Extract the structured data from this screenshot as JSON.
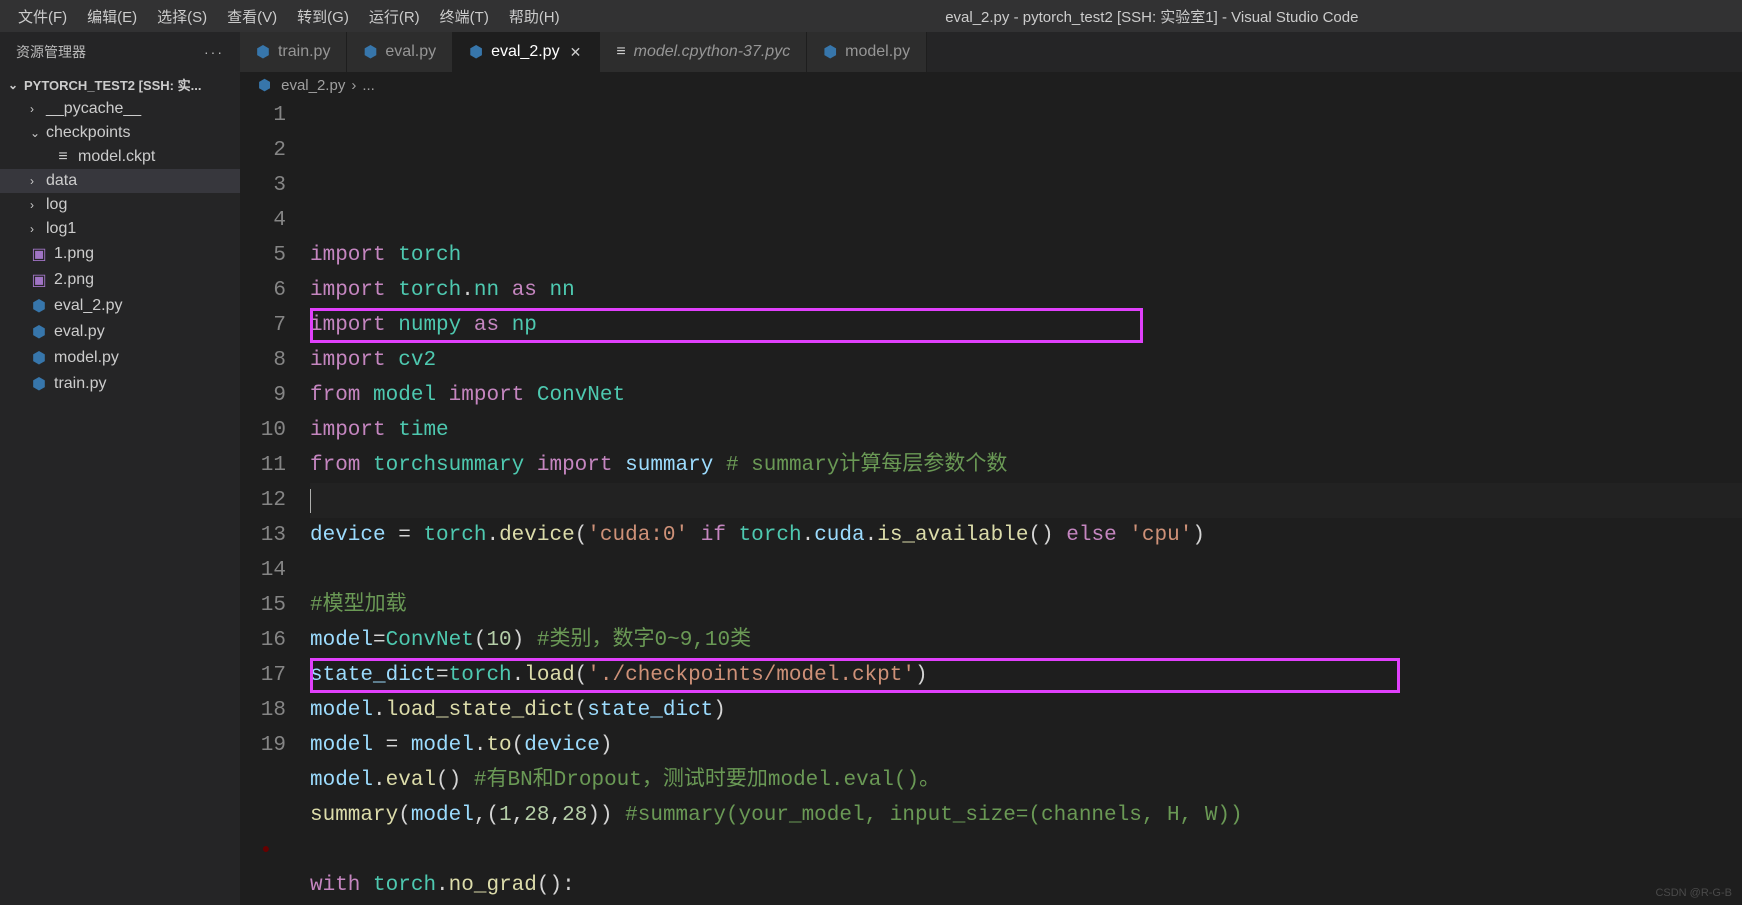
{
  "window": {
    "title": "eval_2.py - pytorch_test2 [SSH: 实验室1] - Visual Studio Code"
  },
  "menu": [
    "文件(F)",
    "编辑(E)",
    "选择(S)",
    "查看(V)",
    "转到(G)",
    "运行(R)",
    "终端(T)",
    "帮助(H)"
  ],
  "sidebar": {
    "title": "资源管理器",
    "root": "PYTORCH_TEST2 [SSH: 实...",
    "items": [
      {
        "type": "folder",
        "name": "__pycache__",
        "level": 1,
        "expanded": false
      },
      {
        "type": "folder",
        "name": "checkpoints",
        "level": 1,
        "expanded": true
      },
      {
        "type": "file",
        "name": "model.ckpt",
        "level": 2,
        "icon": "file"
      },
      {
        "type": "folder",
        "name": "data",
        "level": 1,
        "expanded": false,
        "selected": true
      },
      {
        "type": "folder",
        "name": "log",
        "level": 1,
        "expanded": false
      },
      {
        "type": "folder",
        "name": "log1",
        "level": 1,
        "expanded": false
      },
      {
        "type": "file",
        "name": "1.png",
        "level": 1,
        "icon": "png"
      },
      {
        "type": "file",
        "name": "2.png",
        "level": 1,
        "icon": "png"
      },
      {
        "type": "file",
        "name": "eval_2.py",
        "level": 1,
        "icon": "py"
      },
      {
        "type": "file",
        "name": "eval.py",
        "level": 1,
        "icon": "py"
      },
      {
        "type": "file",
        "name": "model.py",
        "level": 1,
        "icon": "py"
      },
      {
        "type": "file",
        "name": "train.py",
        "level": 1,
        "icon": "py"
      }
    ]
  },
  "tabs": [
    {
      "label": "train.py",
      "icon": "py",
      "active": false
    },
    {
      "label": "eval.py",
      "icon": "py",
      "active": false
    },
    {
      "label": "eval_2.py",
      "icon": "py",
      "active": true,
      "close": true
    },
    {
      "label": "model.cpython-37.pyc",
      "icon": "file",
      "active": false,
      "italic": true
    },
    {
      "label": "model.py",
      "icon": "py",
      "active": false
    }
  ],
  "breadcrumb": {
    "file": "eval_2.py",
    "sep": "›",
    "rest": "..."
  },
  "code": {
    "lines": [
      {
        "n": 1,
        "tokens": [
          [
            "kw",
            "import"
          ],
          [
            "op",
            " "
          ],
          [
            "mod",
            "torch"
          ]
        ]
      },
      {
        "n": 2,
        "tokens": [
          [
            "kw",
            "import"
          ],
          [
            "op",
            " "
          ],
          [
            "mod",
            "torch"
          ],
          [
            "op",
            "."
          ],
          [
            "mod",
            "nn"
          ],
          [
            "op",
            " "
          ],
          [
            "kw",
            "as"
          ],
          [
            "op",
            " "
          ],
          [
            "mod",
            "nn"
          ]
        ]
      },
      {
        "n": 3,
        "tokens": [
          [
            "kw",
            "import"
          ],
          [
            "op",
            " "
          ],
          [
            "mod",
            "numpy"
          ],
          [
            "op",
            " "
          ],
          [
            "kw",
            "as"
          ],
          [
            "op",
            " "
          ],
          [
            "mod",
            "np"
          ]
        ]
      },
      {
        "n": 4,
        "tokens": [
          [
            "kw",
            "import"
          ],
          [
            "op",
            " "
          ],
          [
            "mod",
            "cv2"
          ]
        ]
      },
      {
        "n": 5,
        "tokens": [
          [
            "kw",
            "from"
          ],
          [
            "op",
            " "
          ],
          [
            "mod",
            "model"
          ],
          [
            "op",
            " "
          ],
          [
            "kw",
            "import"
          ],
          [
            "op",
            " "
          ],
          [
            "cls",
            "ConvNet"
          ]
        ]
      },
      {
        "n": 6,
        "tokens": [
          [
            "kw",
            "import"
          ],
          [
            "op",
            " "
          ],
          [
            "mod",
            "time"
          ]
        ]
      },
      {
        "n": 7,
        "tokens": [
          [
            "kw",
            "from"
          ],
          [
            "op",
            " "
          ],
          [
            "mod",
            "torchsummary"
          ],
          [
            "op",
            " "
          ],
          [
            "kw",
            "import"
          ],
          [
            "op",
            " "
          ],
          [
            "var",
            "summary"
          ],
          [
            "op",
            " "
          ],
          [
            "cmt",
            "# summary计算每层参数个数"
          ]
        ]
      },
      {
        "n": 8,
        "tokens": [],
        "cursor": true
      },
      {
        "n": 9,
        "tokens": [
          [
            "var",
            "device"
          ],
          [
            "op",
            " = "
          ],
          [
            "mod",
            "torch"
          ],
          [
            "op",
            "."
          ],
          [
            "fn",
            "device"
          ],
          [
            "op",
            "("
          ],
          [
            "str",
            "'cuda:0'"
          ],
          [
            "op",
            " "
          ],
          [
            "kw",
            "if"
          ],
          [
            "op",
            " "
          ],
          [
            "mod",
            "torch"
          ],
          [
            "op",
            "."
          ],
          [
            "var",
            "cuda"
          ],
          [
            "op",
            "."
          ],
          [
            "fn",
            "is_available"
          ],
          [
            "op",
            "() "
          ],
          [
            "kw",
            "else"
          ],
          [
            "op",
            " "
          ],
          [
            "str",
            "'cpu'"
          ],
          [
            "op",
            ")"
          ]
        ]
      },
      {
        "n": 10,
        "tokens": []
      },
      {
        "n": 11,
        "tokens": [
          [
            "cmt",
            "#模型加载"
          ]
        ]
      },
      {
        "n": 12,
        "tokens": [
          [
            "var",
            "model"
          ],
          [
            "op",
            "="
          ],
          [
            "cls",
            "ConvNet"
          ],
          [
            "op",
            "("
          ],
          [
            "num",
            "10"
          ],
          [
            "op",
            ") "
          ],
          [
            "cmt",
            "#类别，数字0~9,10类"
          ]
        ]
      },
      {
        "n": 13,
        "tokens": [
          [
            "var",
            "state_dict"
          ],
          [
            "op",
            "="
          ],
          [
            "mod",
            "torch"
          ],
          [
            "op",
            "."
          ],
          [
            "fn",
            "load"
          ],
          [
            "op",
            "("
          ],
          [
            "str",
            "'./checkpoints/model.ckpt'"
          ],
          [
            "op",
            ")"
          ]
        ]
      },
      {
        "n": 14,
        "tokens": [
          [
            "var",
            "model"
          ],
          [
            "op",
            "."
          ],
          [
            "fn",
            "load_state_dict"
          ],
          [
            "op",
            "("
          ],
          [
            "var",
            "state_dict"
          ],
          [
            "op",
            ")"
          ]
        ]
      },
      {
        "n": 15,
        "tokens": [
          [
            "var",
            "model"
          ],
          [
            "op",
            " = "
          ],
          [
            "var",
            "model"
          ],
          [
            "op",
            "."
          ],
          [
            "fn",
            "to"
          ],
          [
            "op",
            "("
          ],
          [
            "var",
            "device"
          ],
          [
            "op",
            ")"
          ]
        ]
      },
      {
        "n": 16,
        "tokens": [
          [
            "var",
            "model"
          ],
          [
            "op",
            "."
          ],
          [
            "fn",
            "eval"
          ],
          [
            "op",
            "() "
          ],
          [
            "cmt",
            "#有BN和Dropout，测试时要加model.eval()。"
          ]
        ]
      },
      {
        "n": 17,
        "tokens": [
          [
            "fn",
            "summary"
          ],
          [
            "op",
            "("
          ],
          [
            "var",
            "model"
          ],
          [
            "op",
            ",("
          ],
          [
            "num",
            "1"
          ],
          [
            "op",
            ","
          ],
          [
            "num",
            "28"
          ],
          [
            "op",
            ","
          ],
          [
            "num",
            "28"
          ],
          [
            "op",
            ")) "
          ],
          [
            "cmt",
            "#summary(your_model, input_size=(channels, H, W))"
          ]
        ]
      },
      {
        "n": 18,
        "tokens": [],
        "breakpoint": true
      },
      {
        "n": 19,
        "tokens": [
          [
            "kw",
            "with"
          ],
          [
            "op",
            " "
          ],
          [
            "mod",
            "torch"
          ],
          [
            "op",
            "."
          ],
          [
            "fn",
            "no_grad"
          ],
          [
            "op",
            "():"
          ]
        ]
      }
    ]
  },
  "watermark": "CSDN @R-G-B"
}
